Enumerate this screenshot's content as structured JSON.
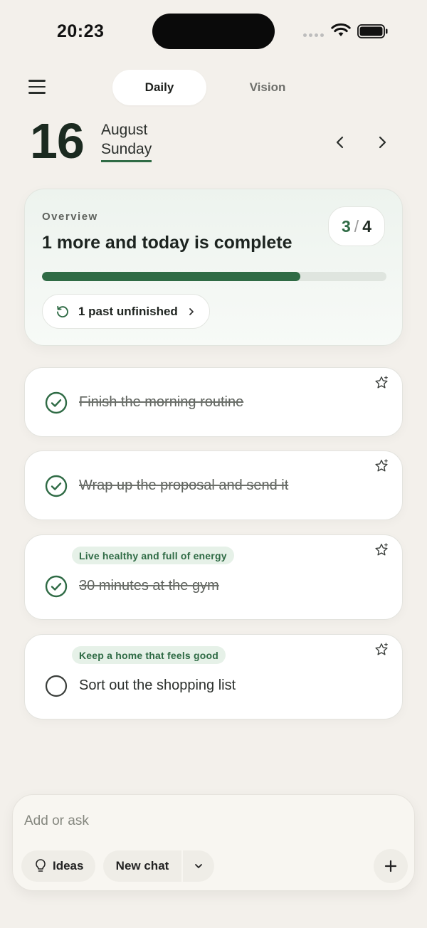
{
  "status_bar": {
    "time": "20:23"
  },
  "header": {
    "tabs": [
      {
        "label": "Daily",
        "active": true
      },
      {
        "label": "Vision",
        "active": false
      }
    ]
  },
  "date": {
    "day": "16",
    "month": "August",
    "weekday": "Sunday"
  },
  "overview": {
    "label": "Overview",
    "title": "1 more and today is complete",
    "completed": "3",
    "separator": "/",
    "total": "4",
    "progress_fraction": 0.75,
    "past_unfinished_label": "1 past unfinished"
  },
  "tasks": [
    {
      "label": "Finish the morning routine",
      "done": true,
      "tag": ""
    },
    {
      "label": "Wrap up the proposal and send it",
      "done": true,
      "tag": ""
    },
    {
      "label": "30 minutes at the gym",
      "done": true,
      "tag": "Live healthy and full of energy"
    },
    {
      "label": "Sort out the shopping list",
      "done": false,
      "tag": "Keep a home that feels good"
    }
  ],
  "composer": {
    "placeholder": "Add or ask",
    "ideas_label": "Ideas",
    "new_chat_label": "New chat"
  },
  "colors": {
    "accent": "#2f6b45",
    "background": "#f3f0eb",
    "tag_bg": "#e6f1e8"
  },
  "icons": [
    "menu-icon",
    "chevron-left-icon",
    "chevron-right-icon",
    "history-icon",
    "star-icon",
    "check-circle-icon",
    "empty-circle-icon",
    "lightbulb-icon",
    "chevron-down-icon",
    "plus-icon",
    "wifi-icon",
    "battery-icon"
  ]
}
